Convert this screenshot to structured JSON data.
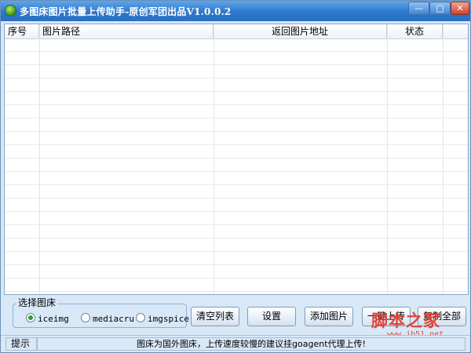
{
  "window": {
    "title": "多图床图片批量上传助手-原创军团出品V1.0.0.2",
    "controls": {
      "minimize": "—",
      "maximize": "□",
      "close": "✕"
    }
  },
  "list": {
    "columns": [
      "序号",
      "图片路径",
      "返回图片地址",
      "状态"
    ],
    "rows": []
  },
  "host_group": {
    "legend": "选择图床",
    "options": [
      "iceimg",
      "mediacru",
      "imgspice"
    ],
    "selected": "iceimg"
  },
  "buttons": {
    "clear": "清空列表",
    "settings": "设置",
    "add": "添加图片",
    "upload": "一键上传",
    "copy_all": "复制全部"
  },
  "status": {
    "label": "提示",
    "message": "图床为国外图床，上传速度较慢的建议挂goagent代理上传!"
  },
  "watermark": {
    "text": "脚本之家",
    "url": "www.jb51.net"
  },
  "colors": {
    "titlebar": "#2d78cf",
    "window_bg": "#d9e8f7",
    "radio_selected": "#2aa02a",
    "watermark": "#e03a2a"
  }
}
